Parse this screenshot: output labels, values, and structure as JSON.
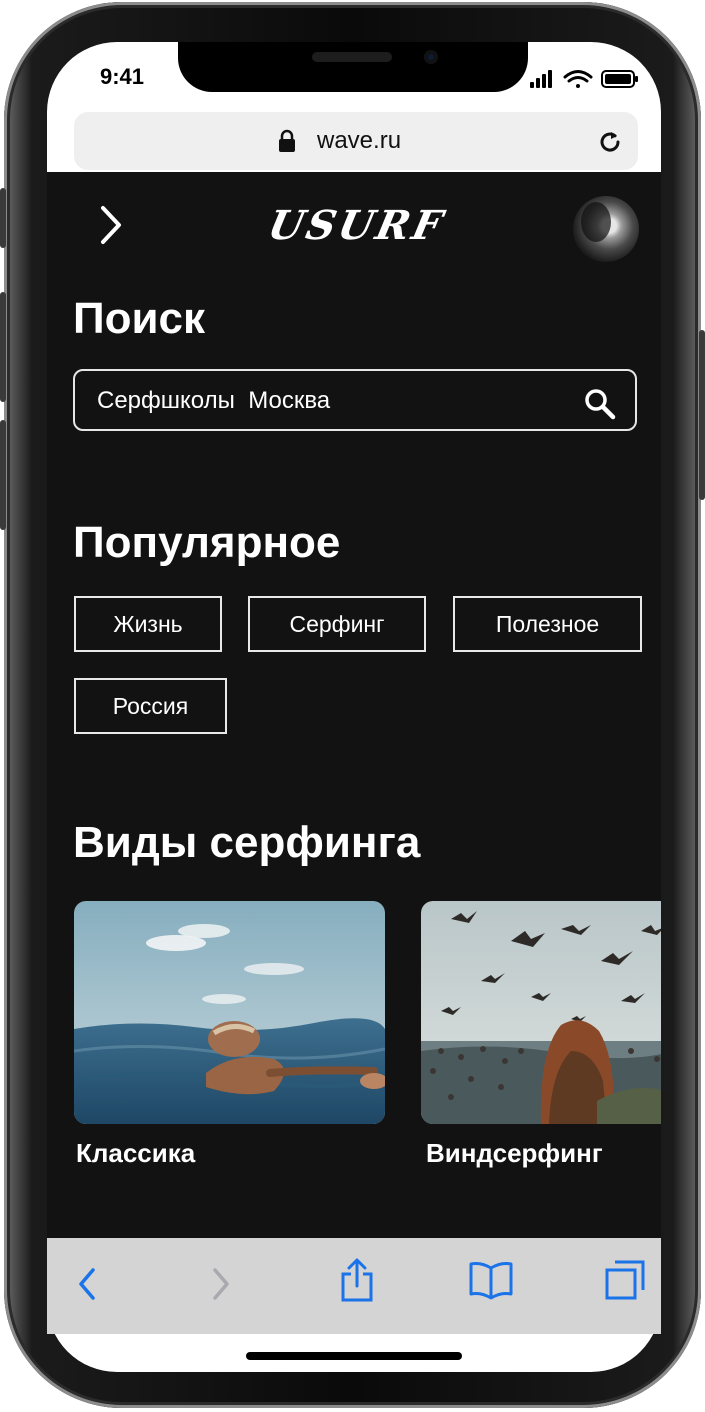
{
  "status_bar": {
    "time": "9:41"
  },
  "browser": {
    "url": "wave.ru"
  },
  "header": {
    "logo": "USURF",
    "icons": {
      "back": "chevron-right-icon",
      "avatar": "user-avatar"
    }
  },
  "search": {
    "title": "Поиск",
    "value": "Серфшколы  Москва",
    "icon": "search-icon"
  },
  "popular": {
    "title": "Популярное",
    "tags": [
      "Жизнь",
      "Серфинг",
      "Полезное",
      "Россия"
    ]
  },
  "surf_types": {
    "title": "Виды серфинга",
    "cards": [
      {
        "label": "Классика"
      },
      {
        "label": "Виндсерфинг"
      }
    ]
  },
  "toolbar": {
    "icons": [
      "back-arrow-icon",
      "forward-arrow-icon",
      "share-icon",
      "bookmarks-icon",
      "tabs-icon"
    ],
    "accent_color": "#1a73e8"
  },
  "colors": {
    "page_background": "#121212",
    "text": "#ffffff",
    "toolbar_background": "#d4d4d4"
  }
}
